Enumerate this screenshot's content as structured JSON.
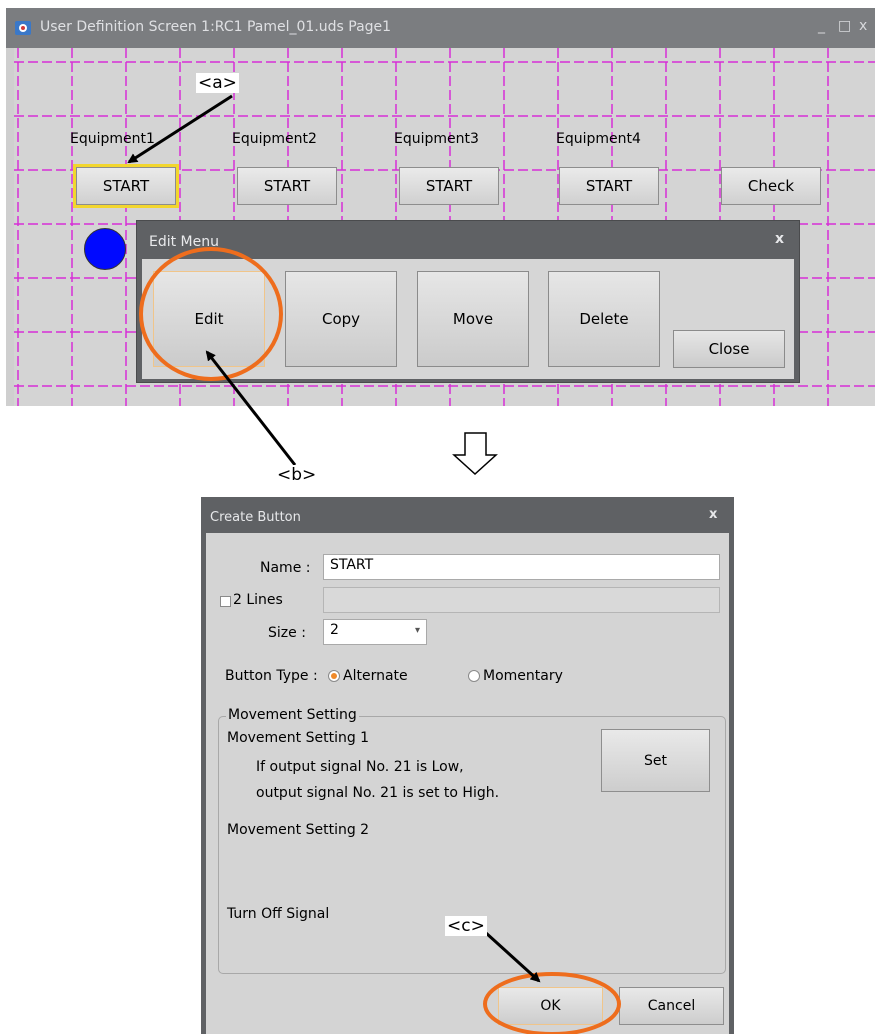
{
  "uds_window": {
    "title": "User Definition Screen 1:RC1 Pamel_01.uds Page1",
    "controls": [
      "_",
      "□",
      "x"
    ]
  },
  "panel": {
    "equipment": [
      {
        "label": "Equipment1",
        "button": "START"
      },
      {
        "label": "Equipment2",
        "button": "START"
      },
      {
        "label": "Equipment3",
        "button": "START"
      },
      {
        "label": "Equipment4",
        "button": "START"
      }
    ],
    "check_button": "Check",
    "lamp_color": "#0009ff",
    "grid_color": "#d62fd6"
  },
  "edit_menu": {
    "title": "Edit Menu",
    "close_glyph": "x",
    "buttons": {
      "edit": "Edit",
      "copy": "Copy",
      "move": "Move",
      "delete": "Delete",
      "close": "Close"
    }
  },
  "create_dialog": {
    "title": "Create Button",
    "close_glyph": "x",
    "name_label": "Name :",
    "name_value": "START",
    "two_lines_label": "2 Lines",
    "two_lines_checked": false,
    "size_label": "Size :",
    "size_value": "2",
    "button_type_label": "Button Type :",
    "button_type_options": [
      "Alternate",
      "Momentary"
    ],
    "button_type_selected": "Alternate",
    "movement_group_label": "Movement Setting",
    "movement_setting_1_label": "Movement Setting 1",
    "movement_setting_1_line1": "If output signal No. 21 is Low,",
    "movement_setting_1_line2": "output signal No. 21 is set to High.",
    "set_button": "Set",
    "movement_setting_2_label": "Movement Setting 2",
    "turn_off_signal_label": "Turn Off Signal",
    "ok_button": "OK",
    "cancel_button": "Cancel"
  },
  "annotations": {
    "a": "<a>",
    "b": "<b>",
    "c": "<c>",
    "highlight_color": "#ee6d1d",
    "arrow_color": "#000000"
  }
}
